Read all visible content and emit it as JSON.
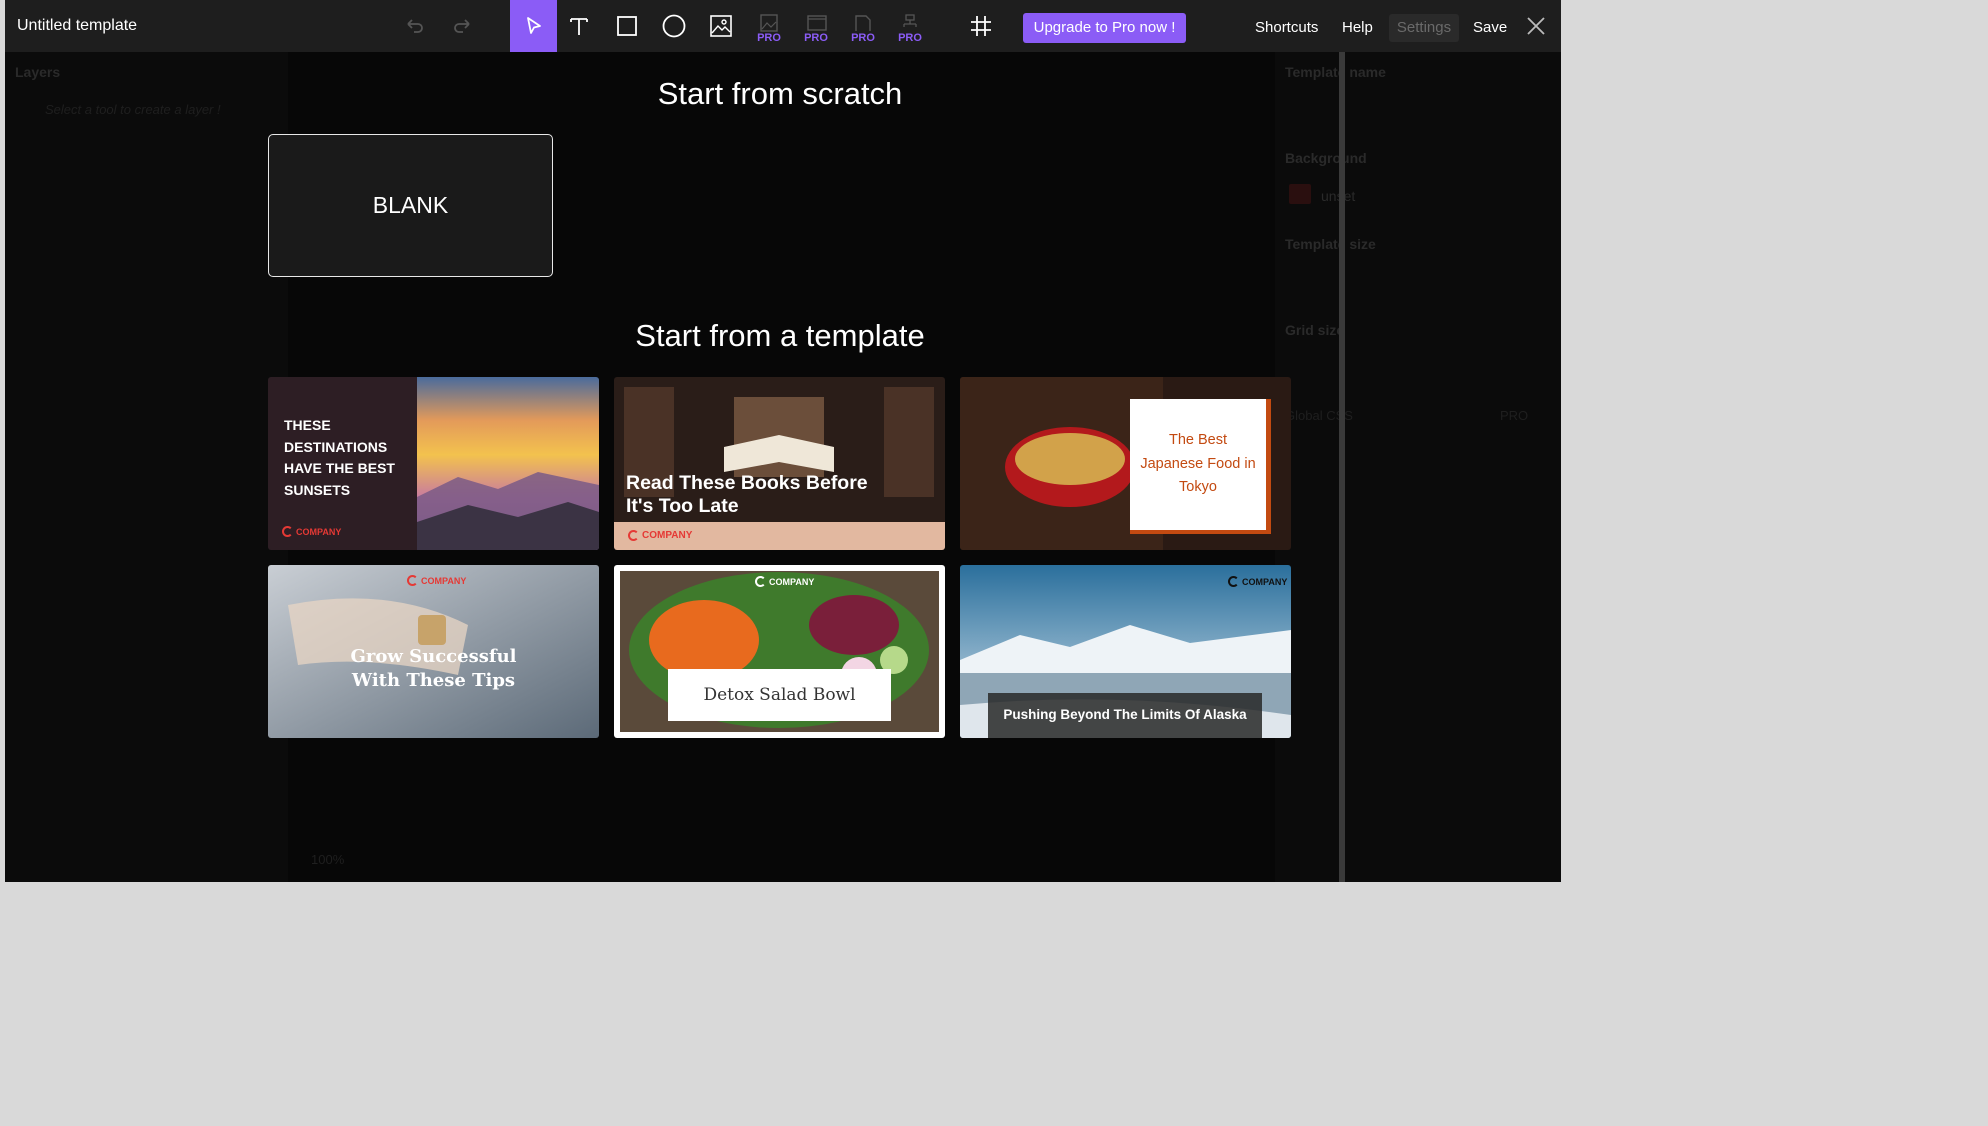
{
  "window": {
    "title": "Untitled template"
  },
  "toolbar": {
    "tools": [
      "undo-icon",
      "redo-icon",
      "pointer-icon",
      "text-icon",
      "rectangle-icon",
      "circle-icon",
      "image-icon"
    ],
    "pro_tools": [
      "image-frame-icon",
      "video-frame-icon",
      "shape-icon",
      "component-icon"
    ],
    "pro_label": "PRO",
    "grid_icon": "grid-icon",
    "upgrade_label": "Upgrade to Pro now !",
    "shortcuts_label": "Shortcuts",
    "help_label": "Help",
    "settings_label": "Settings",
    "save_label": "Save",
    "close_icon": "close-icon"
  },
  "left_panel": {
    "title": "Layers",
    "hint": "Select a tool to create a layer !",
    "zoom": "100%"
  },
  "right_panel": {
    "template_name": "Template name",
    "background": "Background",
    "background_value": "unset",
    "template_size": "Template size",
    "grid_size": "Grid size",
    "global_css": "Global CSS",
    "pro_badge": "PRO"
  },
  "colors": {
    "accent": "#8b5cf6",
    "bg": "#070707",
    "topbar": "#1e1e1e"
  },
  "overlay": {
    "scratch_title": "Start from scratch",
    "blank_label": "BLANK",
    "template_title": "Start from a template",
    "templates": [
      {
        "text": "THESE DESTINATIONS HAVE THE BEST SUNSETS",
        "company": "COMPANY"
      },
      {
        "text": "Read These Books Before It's Too Late",
        "company": "COMPANY"
      },
      {
        "text": "The Best Japanese Food in Tokyo"
      },
      {
        "text": "Grow Successful With These Tips",
        "company": "COMPANY"
      },
      {
        "text": "Detox Salad Bowl",
        "company": "COMPANY"
      },
      {
        "text": "Pushing Beyond The Limits Of Alaska",
        "company": "COMPANY"
      }
    ]
  }
}
